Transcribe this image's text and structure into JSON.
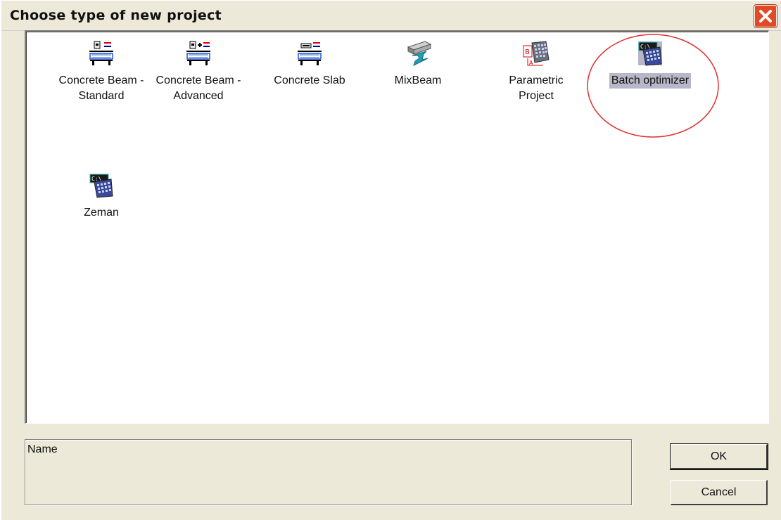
{
  "window": {
    "title": "Choose type of new project"
  },
  "project_types": [
    {
      "label": "Concrete Beam -\nStandard",
      "icon": "concrete-beam-standard-icon"
    },
    {
      "label": "Concrete Beam -\nAdvanced",
      "icon": "concrete-beam-advanced-icon"
    },
    {
      "label": "Concrete Slab",
      "icon": "concrete-slab-icon"
    },
    {
      "label": "MixBeam",
      "icon": "mixbeam-icon"
    },
    {
      "label": "Parametric\nProject",
      "icon": "parametric-project-icon"
    },
    {
      "label": "Batch optimizer",
      "icon": "batch-optimizer-icon",
      "selected": true
    },
    {
      "label": "Zeman",
      "icon": "zeman-icon"
    }
  ],
  "console_icon_text": "C:\\",
  "name_panel": {
    "label": "Name"
  },
  "buttons": {
    "ok": "OK",
    "cancel": "Cancel"
  },
  "colors": {
    "selection": "#b7b7c9",
    "annotation_circle": "#e03030",
    "close_button": "#e24a26"
  }
}
